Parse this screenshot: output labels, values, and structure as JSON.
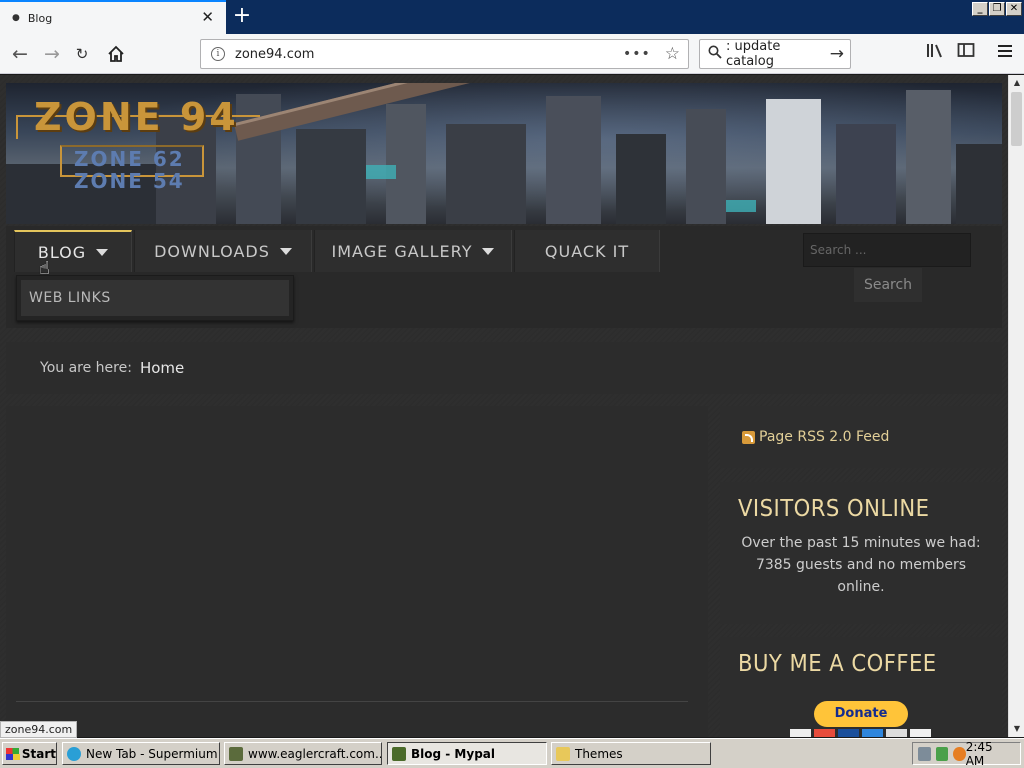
{
  "browser": {
    "tab_title": "Blog",
    "url": "zone94.com",
    "search_text": ": update catalog",
    "window_controls": [
      "_",
      "❐",
      "✕"
    ]
  },
  "site": {
    "logo": {
      "main": "ZONE 94",
      "sub1": "ZONE 62",
      "sub2": "ZONE 54"
    },
    "menu": [
      {
        "label": "BLOG",
        "has_caret": true,
        "active": true
      },
      {
        "label": "DOWNLOADS",
        "has_caret": true,
        "active": false
      },
      {
        "label": "IMAGE GALLERY",
        "has_caret": true,
        "active": false
      },
      {
        "label": "QUACK IT",
        "has_caret": false,
        "active": false
      }
    ],
    "submenu": [
      "WEB LINKS"
    ],
    "search": {
      "placeholder": "Search ...",
      "button": "Search"
    },
    "breadcrumb": {
      "prefix": "You are here:",
      "current": "Home"
    }
  },
  "sidebar": {
    "rss_label": "Page RSS 2.0 Feed",
    "visitors": {
      "title": "VISITORS ONLINE",
      "text": "Over the past 15 minutes we had: 7385 guests and no members online."
    },
    "coffee": {
      "title": "BUY ME A COFFEE",
      "donate_label": "Donate"
    }
  },
  "status_url": "zone94.com",
  "taskbar": {
    "start_label": "Start",
    "tasks": [
      {
        "label": "New Tab - Supermium",
        "active": false
      },
      {
        "label": "www.eaglercraft.com...",
        "active": false
      },
      {
        "label": "Blog - Mypal",
        "active": true
      },
      {
        "label": "Themes",
        "active": false
      }
    ],
    "clock": "2:45 AM"
  },
  "colors": {
    "accent_gold": "#e4c55c",
    "widget_title": "#ecd9a3",
    "page_bg": "#2c2c2c",
    "donate_yellow": "#ffc439"
  }
}
